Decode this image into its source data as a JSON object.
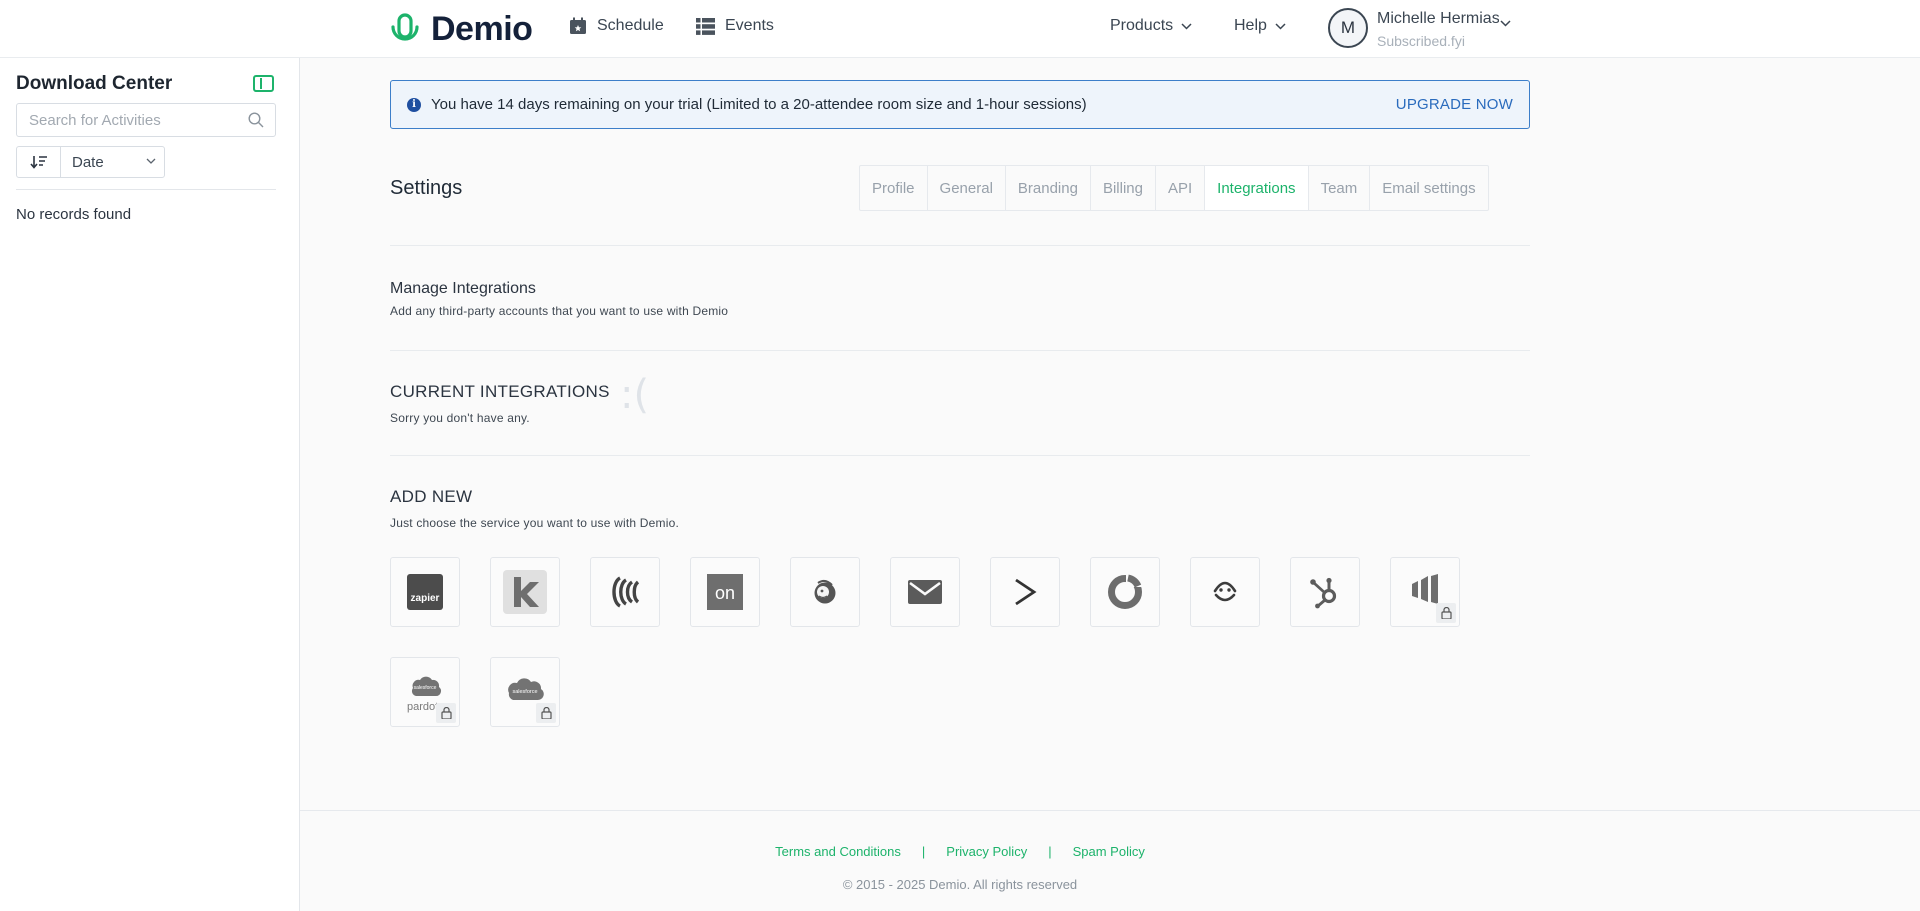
{
  "header": {
    "brand": "Demio",
    "nav": [
      {
        "label": "Schedule",
        "icon": "calendar-icon"
      },
      {
        "label": "Events",
        "icon": "list-icon"
      }
    ],
    "right_menu": [
      {
        "label": "Products"
      },
      {
        "label": "Help"
      }
    ],
    "user": {
      "initial": "M",
      "name": "Michelle Hermias",
      "org": "Subscribed.fyi"
    }
  },
  "sidebar": {
    "title": "Download Center",
    "search_placeholder": "Search for Activities",
    "sort_value": "Date",
    "empty_text": "No records found"
  },
  "banner": {
    "text": "You have 14 days remaining on your trial (Limited to a 20-attendee room size and 1-hour sessions)",
    "cta": "UPGRADE NOW"
  },
  "settings": {
    "title": "Settings",
    "tabs": [
      "Profile",
      "General",
      "Branding",
      "Billing",
      "API",
      "Integrations",
      "Team",
      "Email settings"
    ],
    "active_tab": "Integrations"
  },
  "manage": {
    "title": "Manage Integrations",
    "subtitle": "Add any third-party accounts that you want to use with Demio"
  },
  "current": {
    "title": "CURRENT INTEGRATIONS",
    "subtitle": "Sorry you don't have any.",
    "emoticon": ":("
  },
  "add_new": {
    "title": "ADD NEW",
    "subtitle": "Just choose the service you want to use with Demio.",
    "integrations": [
      {
        "name": "zapier",
        "label": "zapier",
        "locked": false
      },
      {
        "name": "keap",
        "label": "",
        "locked": false
      },
      {
        "name": "constant-contact",
        "label": "",
        "locked": false
      },
      {
        "name": "ontraport",
        "label": "on",
        "locked": false
      },
      {
        "name": "mailchimp",
        "label": "",
        "locked": false
      },
      {
        "name": "campaign-monitor",
        "label": "",
        "locked": false
      },
      {
        "name": "activecampaign",
        "label": "",
        "locked": false
      },
      {
        "name": "convertkit",
        "label": "",
        "locked": false
      },
      {
        "name": "drip",
        "label": "",
        "locked": false
      },
      {
        "name": "hubspot",
        "label": "",
        "locked": false
      },
      {
        "name": "marketo",
        "label": "",
        "locked": true
      },
      {
        "name": "salesforce-pardot",
        "label": "salesforce",
        "label2": "pardot",
        "locked": true
      },
      {
        "name": "salesforce",
        "label": "salesforce",
        "locked": true
      }
    ]
  },
  "footer": {
    "links": [
      "Terms and Conditions",
      "Privacy Policy",
      "Spam Policy"
    ],
    "separator": "|",
    "copyright": "© 2015 - 2025 Demio. All rights reserved"
  },
  "colors": {
    "accent_green": "#1db36b",
    "banner_border": "#3c7ec9",
    "brand_dark": "#14213a"
  }
}
